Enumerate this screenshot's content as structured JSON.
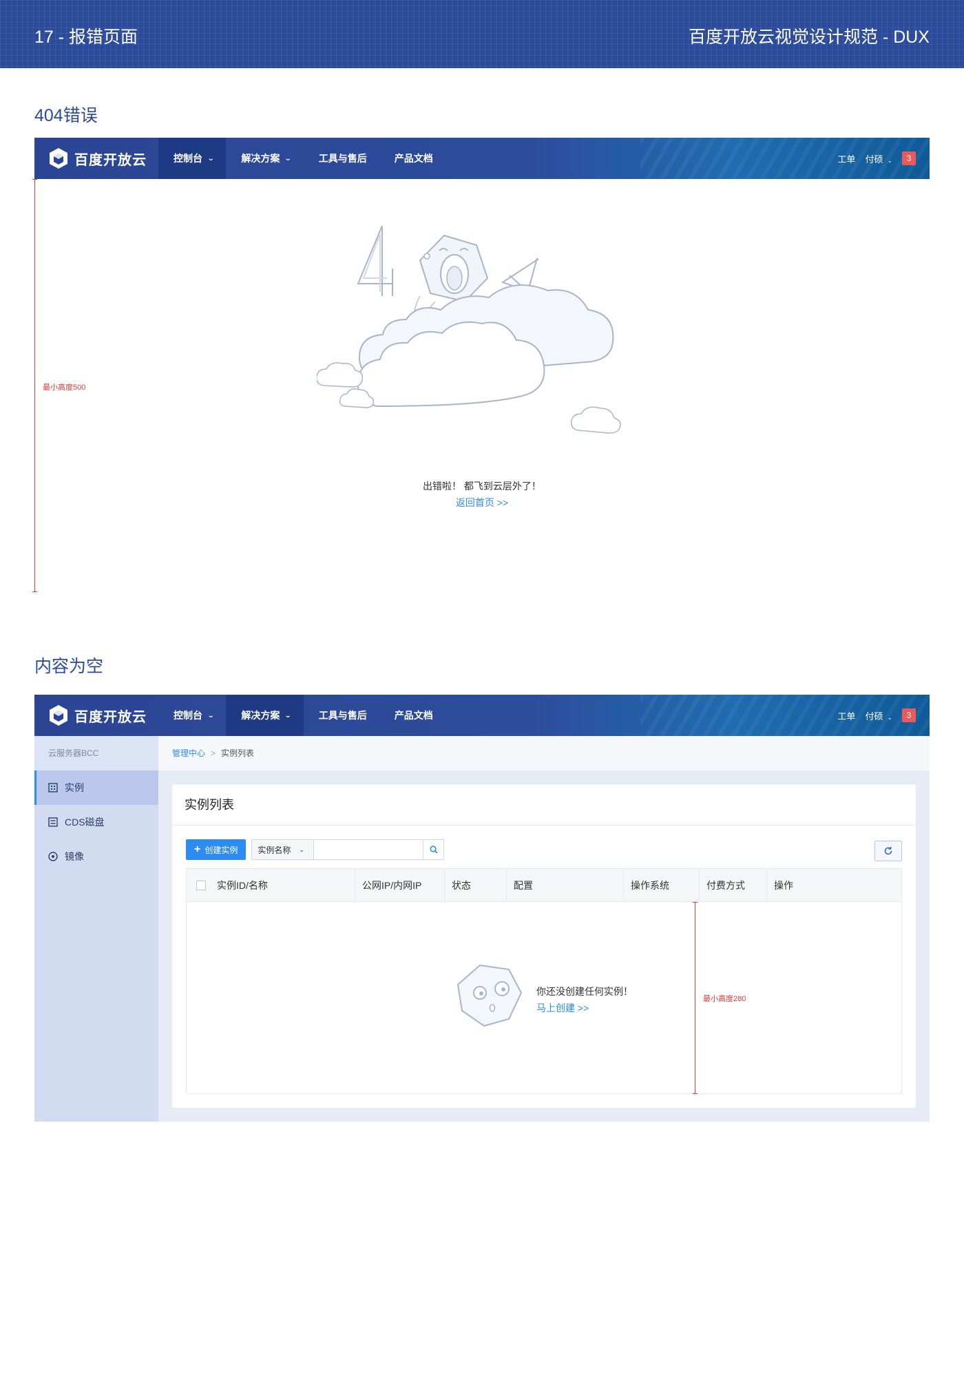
{
  "doc": {
    "page_label": "17 - 报错页面",
    "doc_title": "百度开放云视觉设计规范 - DUX"
  },
  "section_404": {
    "title": "404错误"
  },
  "section_empty": {
    "title": "内容为空"
  },
  "topnav": {
    "logo_text": "百度开放云",
    "items": [
      {
        "label": "控制台",
        "has_dropdown": true
      },
      {
        "label": "解决方案",
        "has_dropdown": true
      },
      {
        "label": "工具与售后",
        "has_dropdown": false
      },
      {
        "label": "产品文档",
        "has_dropdown": false
      }
    ],
    "ticket_label": "工单",
    "user_label": "付硕",
    "badge_count": "3"
  },
  "error_page": {
    "min_height_note": "最小高度500",
    "message": "出错啦！ 都飞到云层外了！",
    "home_link": "返回首页 >>"
  },
  "console": {
    "sidebar": {
      "title": "云服务器BCC",
      "items": [
        {
          "label": "实例",
          "icon": "instance-icon",
          "active": true
        },
        {
          "label": "CDS磁盘",
          "icon": "disk-icon",
          "active": false
        },
        {
          "label": "镜像",
          "icon": "image-icon",
          "active": false
        }
      ]
    },
    "breadcrumb": {
      "parent": "管理中心",
      "current": "实例列表"
    },
    "card_title": "实例列表",
    "create_button": "创建实例",
    "filter_select": "实例名称",
    "search_placeholder": "",
    "table_headers": [
      "实例ID/名称",
      "公网IP/内网IP",
      "状态",
      "配置",
      "操作系统",
      "付费方式",
      "操作"
    ],
    "empty_message": "你还没创建任何实例！",
    "empty_link": "马上创建 >>",
    "min_height_note": "最小高度280"
  },
  "colors": {
    "brand_blue": "#2c4a9a",
    "link_blue": "#2d8cf0",
    "badge_red": "#ea5a5a",
    "measure_red": "#e53935"
  }
}
